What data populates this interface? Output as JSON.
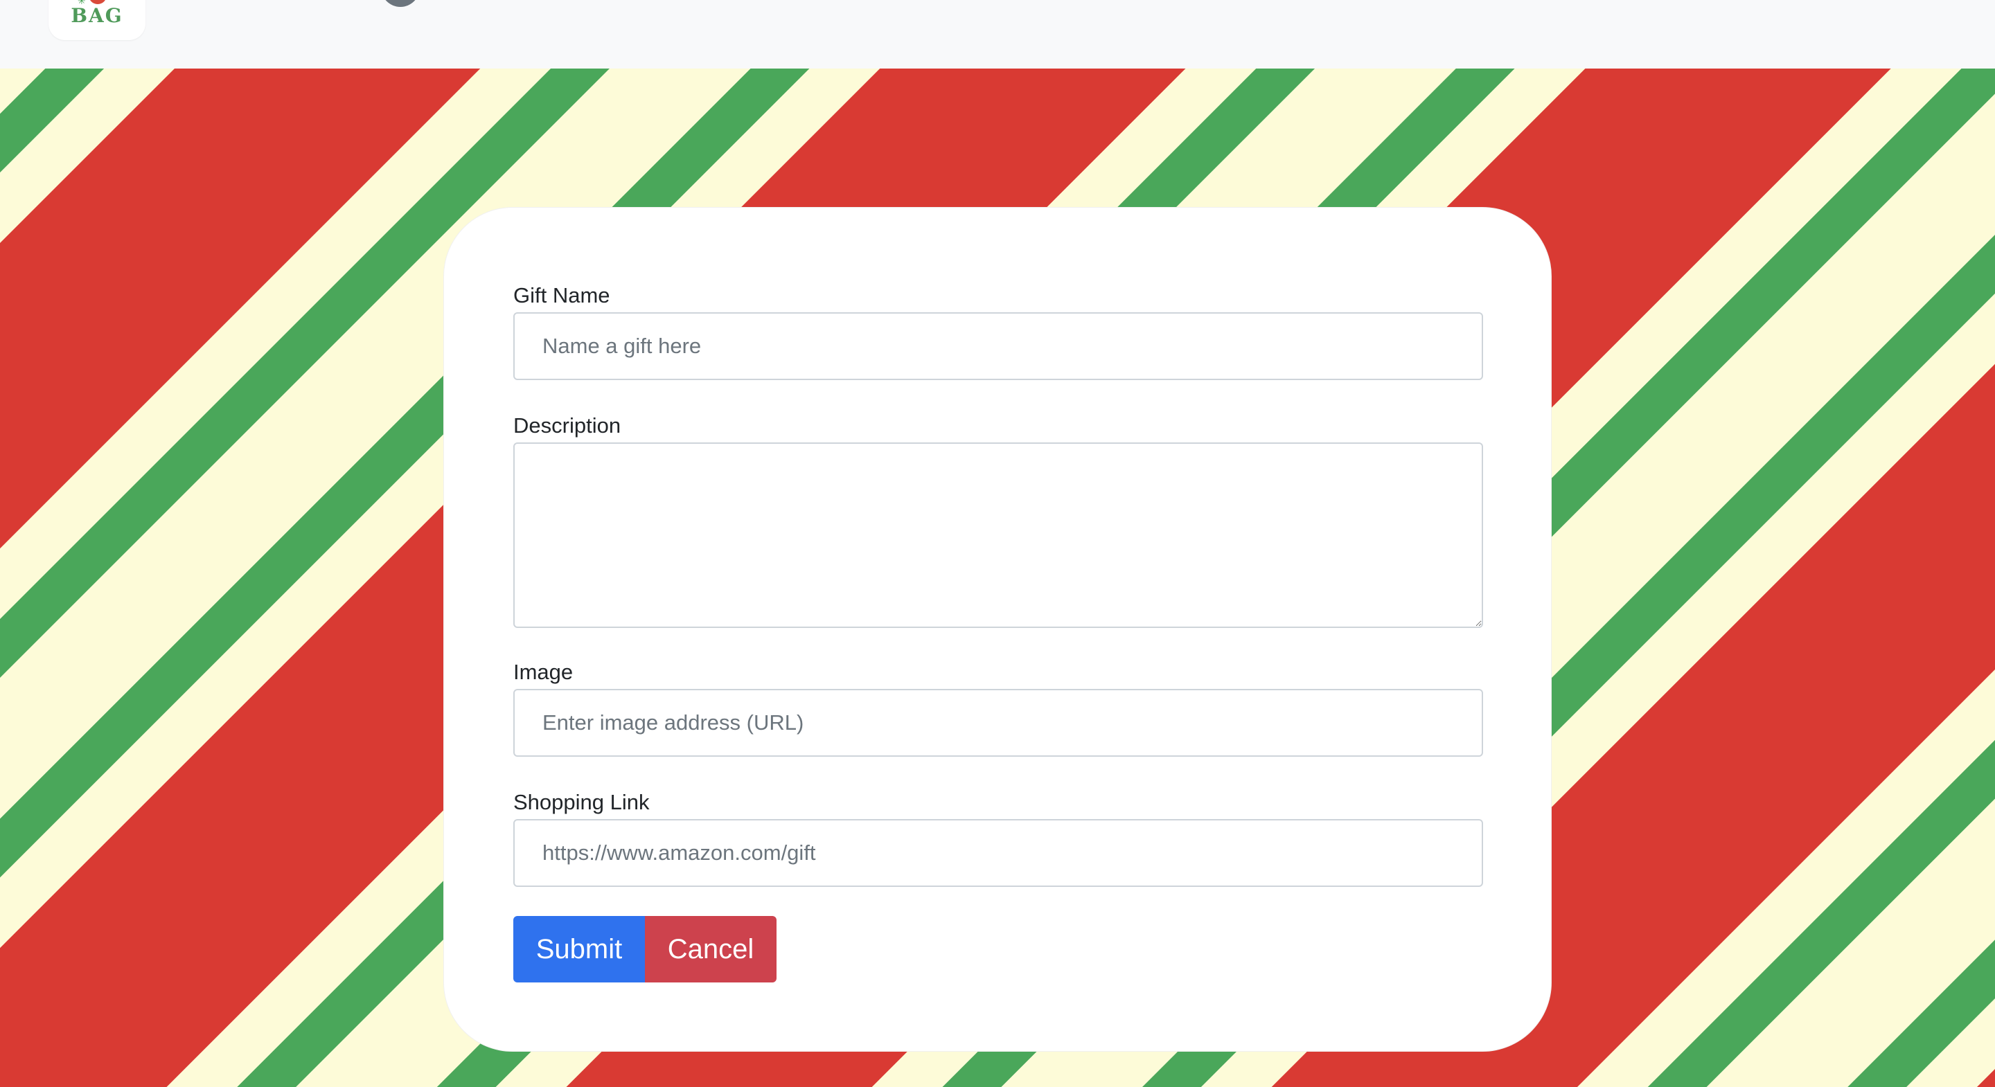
{
  "navbar": {
    "logo_text": "BAG"
  },
  "colors": {
    "stripe_red": "#d93a33",
    "stripe_green": "#4aa75a",
    "stripe_cream": "#fdfbd8",
    "submit_blue": "#2f72ee",
    "cancel_red": "#cd424d"
  },
  "form": {
    "gift_name": {
      "label": "Gift Name",
      "value": "",
      "placeholder": "Name a gift here"
    },
    "description": {
      "label": "Description",
      "value": "",
      "placeholder": ""
    },
    "image": {
      "label": "Image",
      "value": "",
      "placeholder": "Enter image address (URL)"
    },
    "shopping_link": {
      "label": "Shopping Link",
      "value": "",
      "placeholder": "https://www.amazon.com/gift"
    },
    "submit_label": "Submit",
    "cancel_label": "Cancel"
  }
}
